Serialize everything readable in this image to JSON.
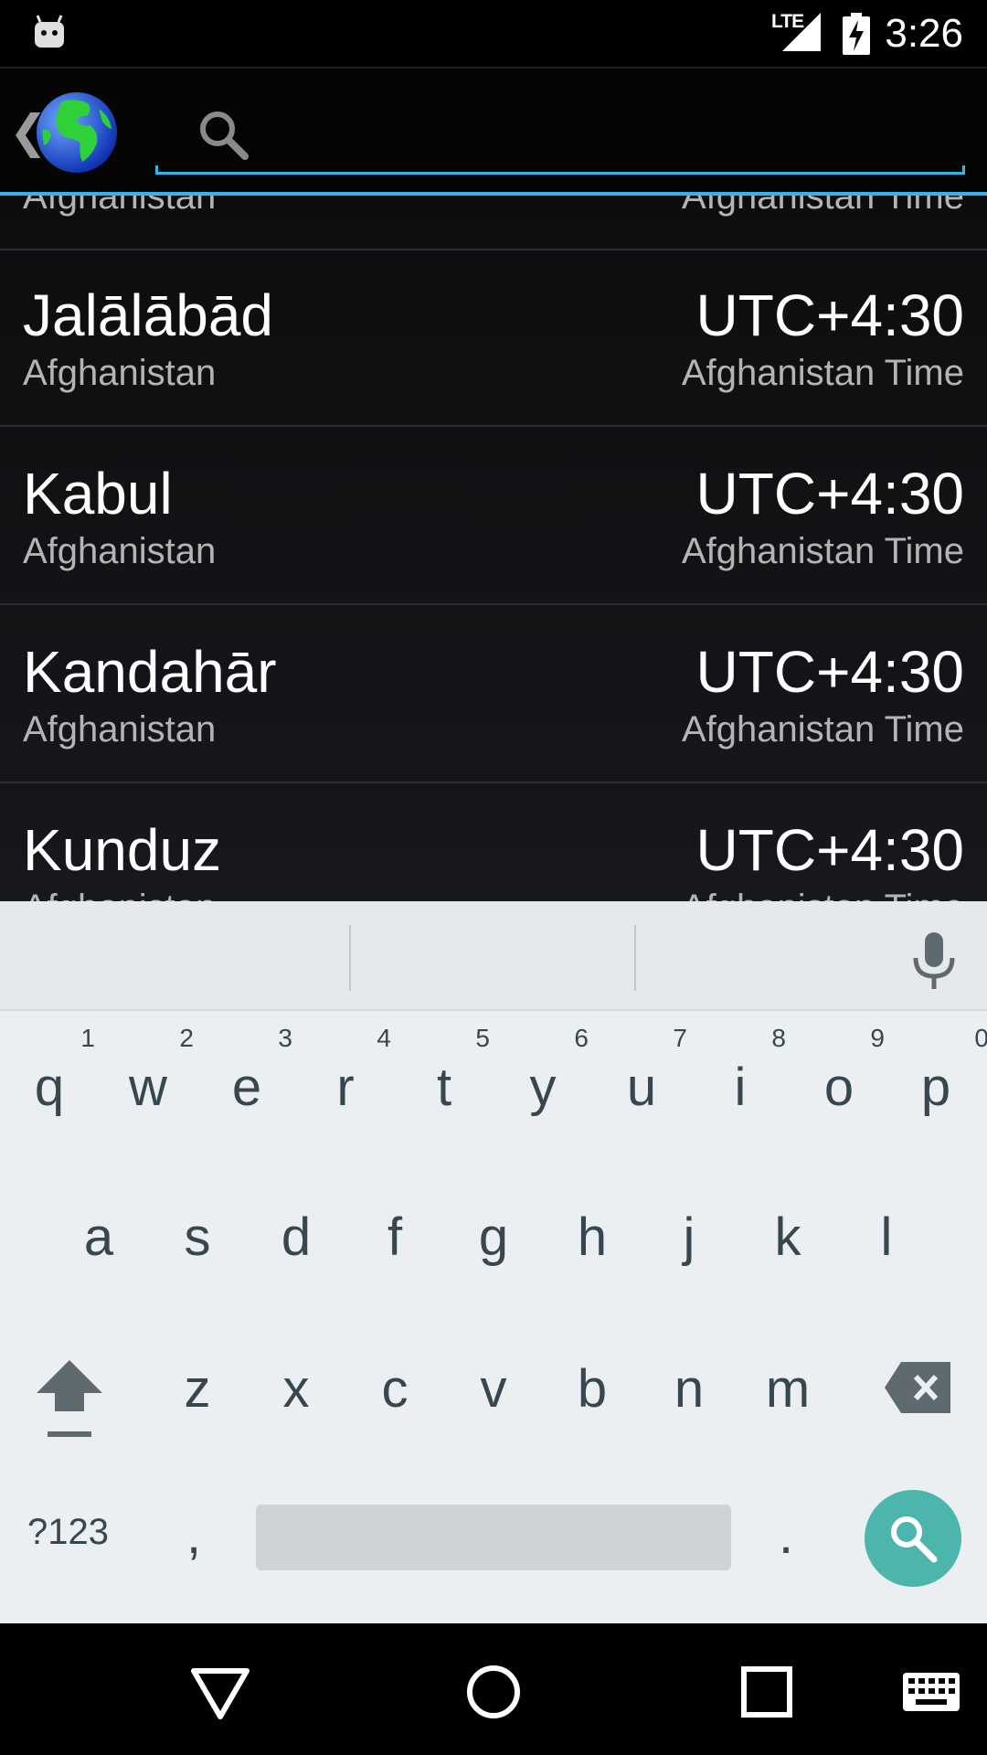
{
  "status_bar": {
    "network": "LTE",
    "time": "3:26"
  },
  "search": {
    "value": "",
    "placeholder": ""
  },
  "list": {
    "partial_top": {
      "city": "Afghanistan",
      "zone": "Afghanistan Time"
    },
    "rows": [
      {
        "city": "Jalālābād",
        "country": "Afghanistan",
        "offset": "UTC+4:30",
        "zone": "Afghanistan Time"
      },
      {
        "city": "Kabul",
        "country": "Afghanistan",
        "offset": "UTC+4:30",
        "zone": "Afghanistan Time"
      },
      {
        "city": "Kandahār",
        "country": "Afghanistan",
        "offset": "UTC+4:30",
        "zone": "Afghanistan Time"
      },
      {
        "city": "Kunduz",
        "country": "Afghanistan",
        "offset": "UTC+4:30",
        "zone": "Afghanistan Time"
      }
    ]
  },
  "keyboard": {
    "row1": [
      "q",
      "w",
      "e",
      "r",
      "t",
      "y",
      "u",
      "i",
      "o",
      "p"
    ],
    "row1_hints": [
      "1",
      "2",
      "3",
      "4",
      "5",
      "6",
      "7",
      "8",
      "9",
      "0"
    ],
    "row2": [
      "a",
      "s",
      "d",
      "f",
      "g",
      "h",
      "j",
      "k",
      "l"
    ],
    "row3": [
      "z",
      "x",
      "c",
      "v",
      "b",
      "n",
      "m"
    ],
    "symbols_label": "?123",
    "comma": ",",
    "period": ".",
    "accent_color": "#4db6ac"
  },
  "colors": {
    "search_underline": "#33b5e5",
    "keyboard_bg": "#eceff1"
  }
}
